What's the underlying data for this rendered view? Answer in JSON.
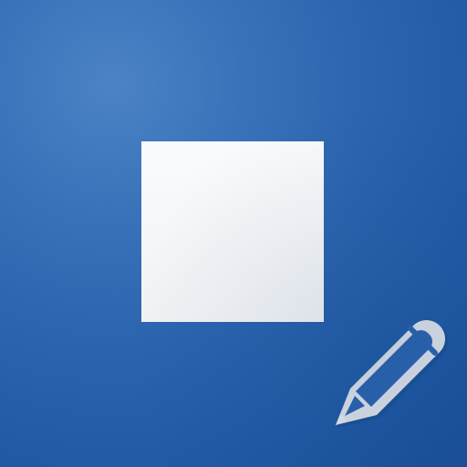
{
  "app_icon": {
    "name": "notes-editor-icon",
    "colors": {
      "background": "#2a63ae",
      "background_highlight": "#4b83c5",
      "square": "#f4f6f8",
      "pencil": "#d7dde5"
    },
    "square_icon": "blank-square-icon",
    "pencil_icon": "pencil-icon"
  }
}
